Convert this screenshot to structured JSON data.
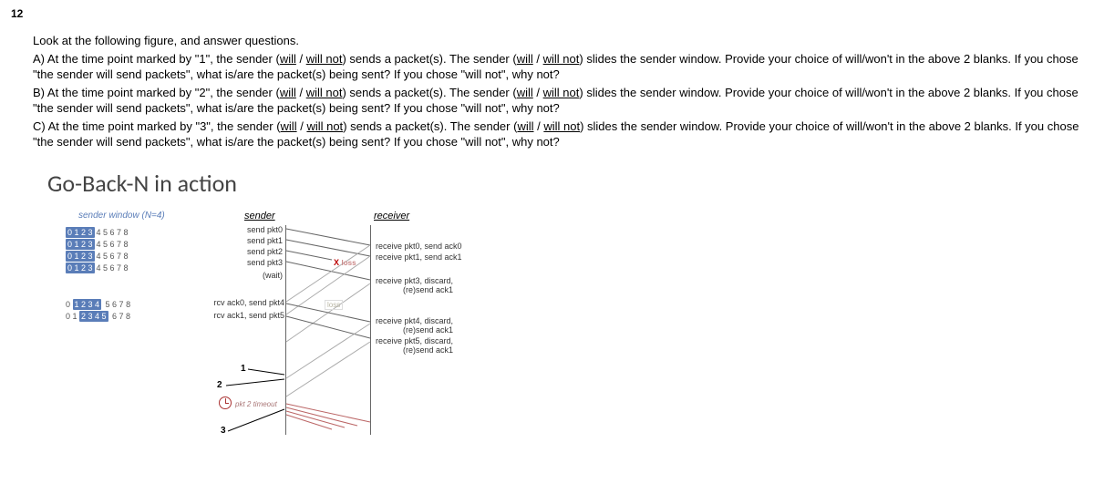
{
  "qnum": "12",
  "prompt": {
    "lead": "Look at the following figure, and answer questions.",
    "a1": "A) At the time point marked by \"1\", the sender (",
    "a2": ") sends a packet(s). The sender (",
    "a3": ") slides the sender window. Provide your choice of will/won't in the above 2 blanks. If you chose \"the sender will send packets\", what is/are the packet(s) being sent? If you chose \"will not\", why not?",
    "b1": "B) At the time point marked by \"2\", the sender (",
    "b2": ") sends a packet(s). The sender (",
    "b3": ") slides the sender window.  Provide your choice of will/won't in the above 2 blanks. If you chose \"the sender will send packets\", what is/are the packet(s) being sent? If you chose \"will not\", why not?",
    "c1": "C) At the time point marked by \"3\", the sender (",
    "c2": ") sends a packet(s). The sender (",
    "c3": ") slides the sender window.  Provide your choice of will/won't in the above 2 blanks. If you chose \"the sender will send packets\", what is/are the packet(s) being sent? If you chose \"will not\", why not?",
    "will": "will",
    "slash": " / ",
    "willnot": "will not"
  },
  "figTitle": "Go-Back-N in action",
  "fig": {
    "swLabel": "sender window (N=4)",
    "senderH": "sender",
    "receiverH": "receiver",
    "win": {
      "r1_box": "0 1 2 3",
      "r1_rest": "4 5 6 7 8",
      "r2_box": "0 1 2 3",
      "r2_rest": "4 5 6 7 8",
      "r3_box": "0 1 2 3",
      "r3_rest": "4 5 6 7 8",
      "r4_box": "0 1 2 3",
      "r4_rest": "4 5 6 7 8",
      "r5_pre": "0 ",
      "r5_box": "1 2 3 4",
      "r5_rest": " 5 6 7 8",
      "r6_pre": "0 1 ",
      "r6_box": "2 3 4 5",
      "r6_rest": " 6 7 8"
    },
    "sevt": {
      "sp0": "send  pkt0",
      "sp1": "send  pkt1",
      "sp2": "send  pkt2",
      "sp3": "send  pkt3",
      "wait": "(wait)",
      "rcv0": "rcv ack0, send pkt4",
      "rcv1": "rcv ack1, send pkt5"
    },
    "revt": {
      "r0": "receive pkt0, send ack0",
      "r1": "receive pkt1, send ack1",
      "r3a": "receive pkt3, discard,",
      "r3b": "(re)send ack1",
      "r4a": "receive pkt4, discard,",
      "r4b": "(re)send ack1",
      "r5a": "receive pkt5, discard,",
      "r5b": "(re)send ack1"
    },
    "loss": "loss",
    "xmark": "X",
    "timeout": "pkt 2 timeout",
    "m1": "1",
    "m2": "2",
    "m3": "3"
  }
}
